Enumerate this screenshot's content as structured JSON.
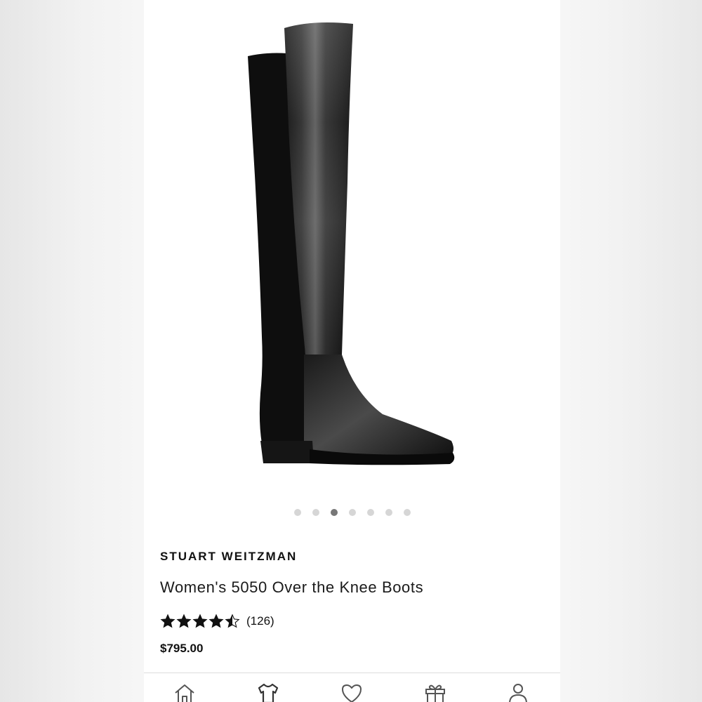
{
  "product": {
    "brand": "STUART WEITZMAN",
    "title": "Women's 5050 Over the Knee Boots",
    "rating": 4.5,
    "rating_max": 5,
    "review_count": "(126)",
    "price": "$795.00",
    "image_description": "black-over-the-knee-boot"
  },
  "gallery": {
    "total_images": 7,
    "active_index": 2
  },
  "tabbar": {
    "items": [
      {
        "icon": "home-icon"
      },
      {
        "icon": "tshirt-icon"
      },
      {
        "icon": "heart-icon"
      },
      {
        "icon": "gift-icon"
      },
      {
        "icon": "account-icon"
      }
    ]
  },
  "colors": {
    "star": "#111111",
    "dot_active": "#777777",
    "dot_inactive": "#d6d6d6",
    "icon": "#555555"
  }
}
